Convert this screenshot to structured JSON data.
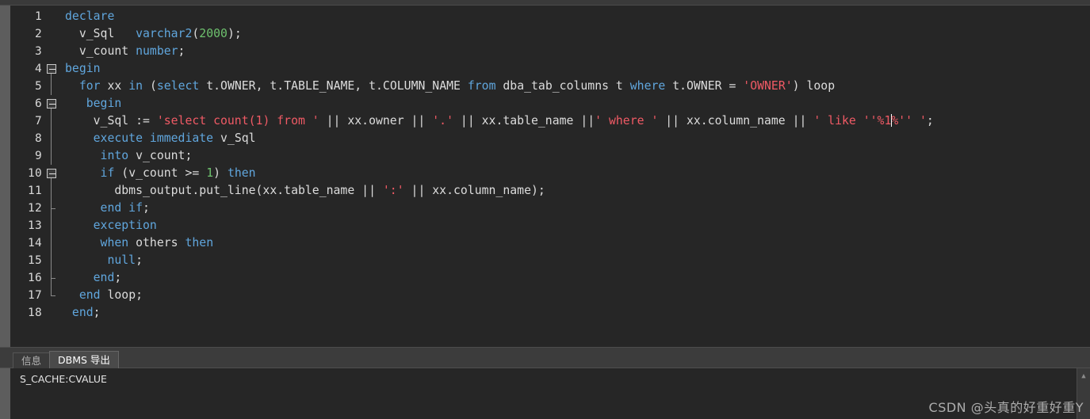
{
  "app": {
    "title": "PL/SQL Developer - SQL Window"
  },
  "editor": {
    "first_line": 1,
    "total_lines": 18,
    "lines": [
      {
        "n": "1",
        "fold": "none",
        "tokens": [
          {
            "t": "declare",
            "c": "kw"
          }
        ],
        "indent": " "
      },
      {
        "n": "2",
        "fold": "none",
        "tokens": [
          {
            "t": "  v_Sql   ",
            "c": "pl"
          },
          {
            "t": "varchar2",
            "c": "kw"
          },
          {
            "t": "(",
            "c": "op"
          },
          {
            "t": "2000",
            "c": "num"
          },
          {
            "t": ");",
            "c": "op"
          }
        ],
        "indent": " "
      },
      {
        "n": "3",
        "fold": "none",
        "tokens": [
          {
            "t": "  v_count ",
            "c": "pl"
          },
          {
            "t": "number",
            "c": "kw"
          },
          {
            "t": ";",
            "c": "op"
          }
        ],
        "indent": " "
      },
      {
        "n": "4",
        "fold": "open",
        "tokens": [
          {
            "t": "begin",
            "c": "kw"
          }
        ],
        "indent": ""
      },
      {
        "n": "5",
        "fold": "bar",
        "tokens": [
          {
            "t": "  ",
            "c": "pl"
          },
          {
            "t": "for",
            "c": "kw"
          },
          {
            "t": " xx ",
            "c": "pl"
          },
          {
            "t": "in",
            "c": "kw"
          },
          {
            "t": " (",
            "c": "op"
          },
          {
            "t": "select",
            "c": "kw"
          },
          {
            "t": " t.OWNER, t.TABLE_NAME, t.COLUMN_NAME ",
            "c": "pl"
          },
          {
            "t": "from",
            "c": "kw"
          },
          {
            "t": " dba_tab_columns t ",
            "c": "pl"
          },
          {
            "t": "where",
            "c": "kw"
          },
          {
            "t": " t.OWNER = ",
            "c": "pl"
          },
          {
            "t": "'OWNER'",
            "c": "str"
          },
          {
            "t": ") loop",
            "c": "pl"
          }
        ],
        "indent": ""
      },
      {
        "n": "6",
        "fold": "open",
        "tokens": [
          {
            "t": "   ",
            "c": "pl"
          },
          {
            "t": "begin",
            "c": "kw"
          }
        ],
        "indent": ""
      },
      {
        "n": "7",
        "fold": "bar",
        "tokens": [
          {
            "t": "    v_Sql := ",
            "c": "pl"
          },
          {
            "t": "'select count(1) from '",
            "c": "str"
          },
          {
            "t": " || xx.owner || ",
            "c": "pl"
          },
          {
            "t": "'.'",
            "c": "str"
          },
          {
            "t": " || xx.table_name ||",
            "c": "pl"
          },
          {
            "t": "' where '",
            "c": "str"
          },
          {
            "t": " || xx.column_name || ",
            "c": "pl"
          },
          {
            "t": "' like ''%1",
            "c": "str"
          },
          {
            "t": "__CARET__",
            "c": "caret"
          },
          {
            "t": "%'' '",
            "c": "str"
          },
          {
            "t": ";",
            "c": "pl"
          }
        ],
        "indent": ""
      },
      {
        "n": "8",
        "fold": "bar",
        "tokens": [
          {
            "t": "    ",
            "c": "pl"
          },
          {
            "t": "execute immediate",
            "c": "kw"
          },
          {
            "t": " v_Sql",
            "c": "pl"
          }
        ],
        "indent": ""
      },
      {
        "n": "9",
        "fold": "bar",
        "tokens": [
          {
            "t": "     ",
            "c": "pl"
          },
          {
            "t": "into",
            "c": "kw"
          },
          {
            "t": " v_count;",
            "c": "pl"
          }
        ],
        "indent": ""
      },
      {
        "n": "10",
        "fold": "open",
        "tokens": [
          {
            "t": "     ",
            "c": "pl"
          },
          {
            "t": "if",
            "c": "kw"
          },
          {
            "t": " (v_count >= ",
            "c": "pl"
          },
          {
            "t": "1",
            "c": "num"
          },
          {
            "t": ") ",
            "c": "pl"
          },
          {
            "t": "then",
            "c": "kw"
          }
        ],
        "indent": ""
      },
      {
        "n": "11",
        "fold": "bar",
        "tokens": [
          {
            "t": "       dbms_output.put_line(xx.table_name || ",
            "c": "pl"
          },
          {
            "t": "':'",
            "c": "str"
          },
          {
            "t": " || xx.column_name);",
            "c": "pl"
          }
        ],
        "indent": ""
      },
      {
        "n": "12",
        "fold": "close",
        "tokens": [
          {
            "t": "     ",
            "c": "pl"
          },
          {
            "t": "end if",
            "c": "kw"
          },
          {
            "t": ";",
            "c": "pl"
          }
        ],
        "indent": ""
      },
      {
        "n": "13",
        "fold": "bar",
        "tokens": [
          {
            "t": "    ",
            "c": "pl"
          },
          {
            "t": "exception",
            "c": "kw"
          }
        ],
        "indent": ""
      },
      {
        "n": "14",
        "fold": "bar",
        "tokens": [
          {
            "t": "     ",
            "c": "pl"
          },
          {
            "t": "when",
            "c": "kw"
          },
          {
            "t": " others ",
            "c": "pl"
          },
          {
            "t": "then",
            "c": "kw"
          }
        ],
        "indent": ""
      },
      {
        "n": "15",
        "fold": "bar",
        "tokens": [
          {
            "t": "      ",
            "c": "pl"
          },
          {
            "t": "null",
            "c": "kw"
          },
          {
            "t": ";",
            "c": "pl"
          }
        ],
        "indent": ""
      },
      {
        "n": "16",
        "fold": "close",
        "tokens": [
          {
            "t": "    ",
            "c": "pl"
          },
          {
            "t": "end",
            "c": "kw"
          },
          {
            "t": ";",
            "c": "pl"
          }
        ],
        "indent": ""
      },
      {
        "n": "17",
        "fold": "last",
        "tokens": [
          {
            "t": "  ",
            "c": "pl"
          },
          {
            "t": "end",
            "c": "kw"
          },
          {
            "t": " loop;",
            "c": "pl"
          }
        ],
        "indent": ""
      },
      {
        "n": "18",
        "fold": "none",
        "tokens": [
          {
            "t": " ",
            "c": "pl"
          },
          {
            "t": "end",
            "c": "kw"
          },
          {
            "t": ";",
            "c": "pl"
          }
        ],
        "indent": ""
      }
    ],
    "caret": {
      "line": 7,
      "description": "text-cursor"
    }
  },
  "bottom_panel": {
    "tabs": [
      {
        "label": "信息",
        "active": false
      },
      {
        "label": "DBMS 导出",
        "active": true
      }
    ],
    "output_lines": [
      "S_CACHE:CVALUE"
    ],
    "scroll_up_icon": "chevron-up-icon"
  },
  "watermark": {
    "text": "CSDN @头真的好重好重Y"
  },
  "colors": {
    "editor_background": "#262626",
    "panel_background": "#3c3c3c",
    "rail": "#5d5d5d",
    "keyword": "#60a6dd",
    "string": "#f05a65",
    "number": "#6ec26e",
    "plain_text": "#dcdcdc",
    "line_number": "#d9d9d9",
    "active_tab_background": "#4a4a4a",
    "inactive_tab_background": "#3a3a3a"
  }
}
